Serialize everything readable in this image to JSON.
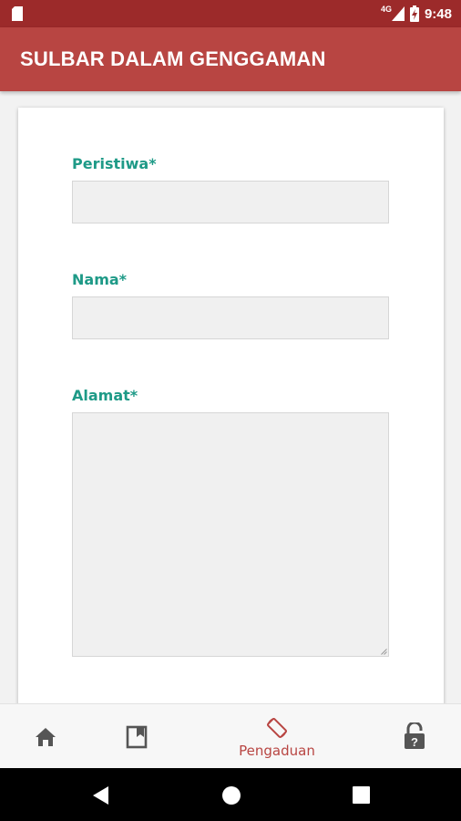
{
  "status_bar": {
    "network_label": "4G",
    "time": "9:48",
    "icons": [
      "sim-card-icon",
      "signal-icon",
      "battery-charging-icon"
    ]
  },
  "app_bar": {
    "title": "SULBAR DALAM GENGGAMAN"
  },
  "form": {
    "fields": [
      {
        "label": "Peristiwa*",
        "value": "",
        "type": "text"
      },
      {
        "label": "Nama*",
        "value": "",
        "type": "text"
      },
      {
        "label": "Alamat*",
        "value": "",
        "type": "textarea"
      }
    ]
  },
  "bottom_nav": {
    "items": [
      {
        "icon": "home-icon",
        "label": ""
      },
      {
        "icon": "bookmark-icon",
        "label": ""
      },
      {
        "icon": "screen-rotation-icon",
        "label": "Pengaduan",
        "active": true
      },
      {
        "icon": "lock-question-icon",
        "label": ""
      }
    ]
  },
  "colors": {
    "status_bar": "#9c2a2a",
    "app_bar": "#b84542",
    "label_accent": "#1e9a87",
    "input_bg": "#f0f0f0"
  }
}
